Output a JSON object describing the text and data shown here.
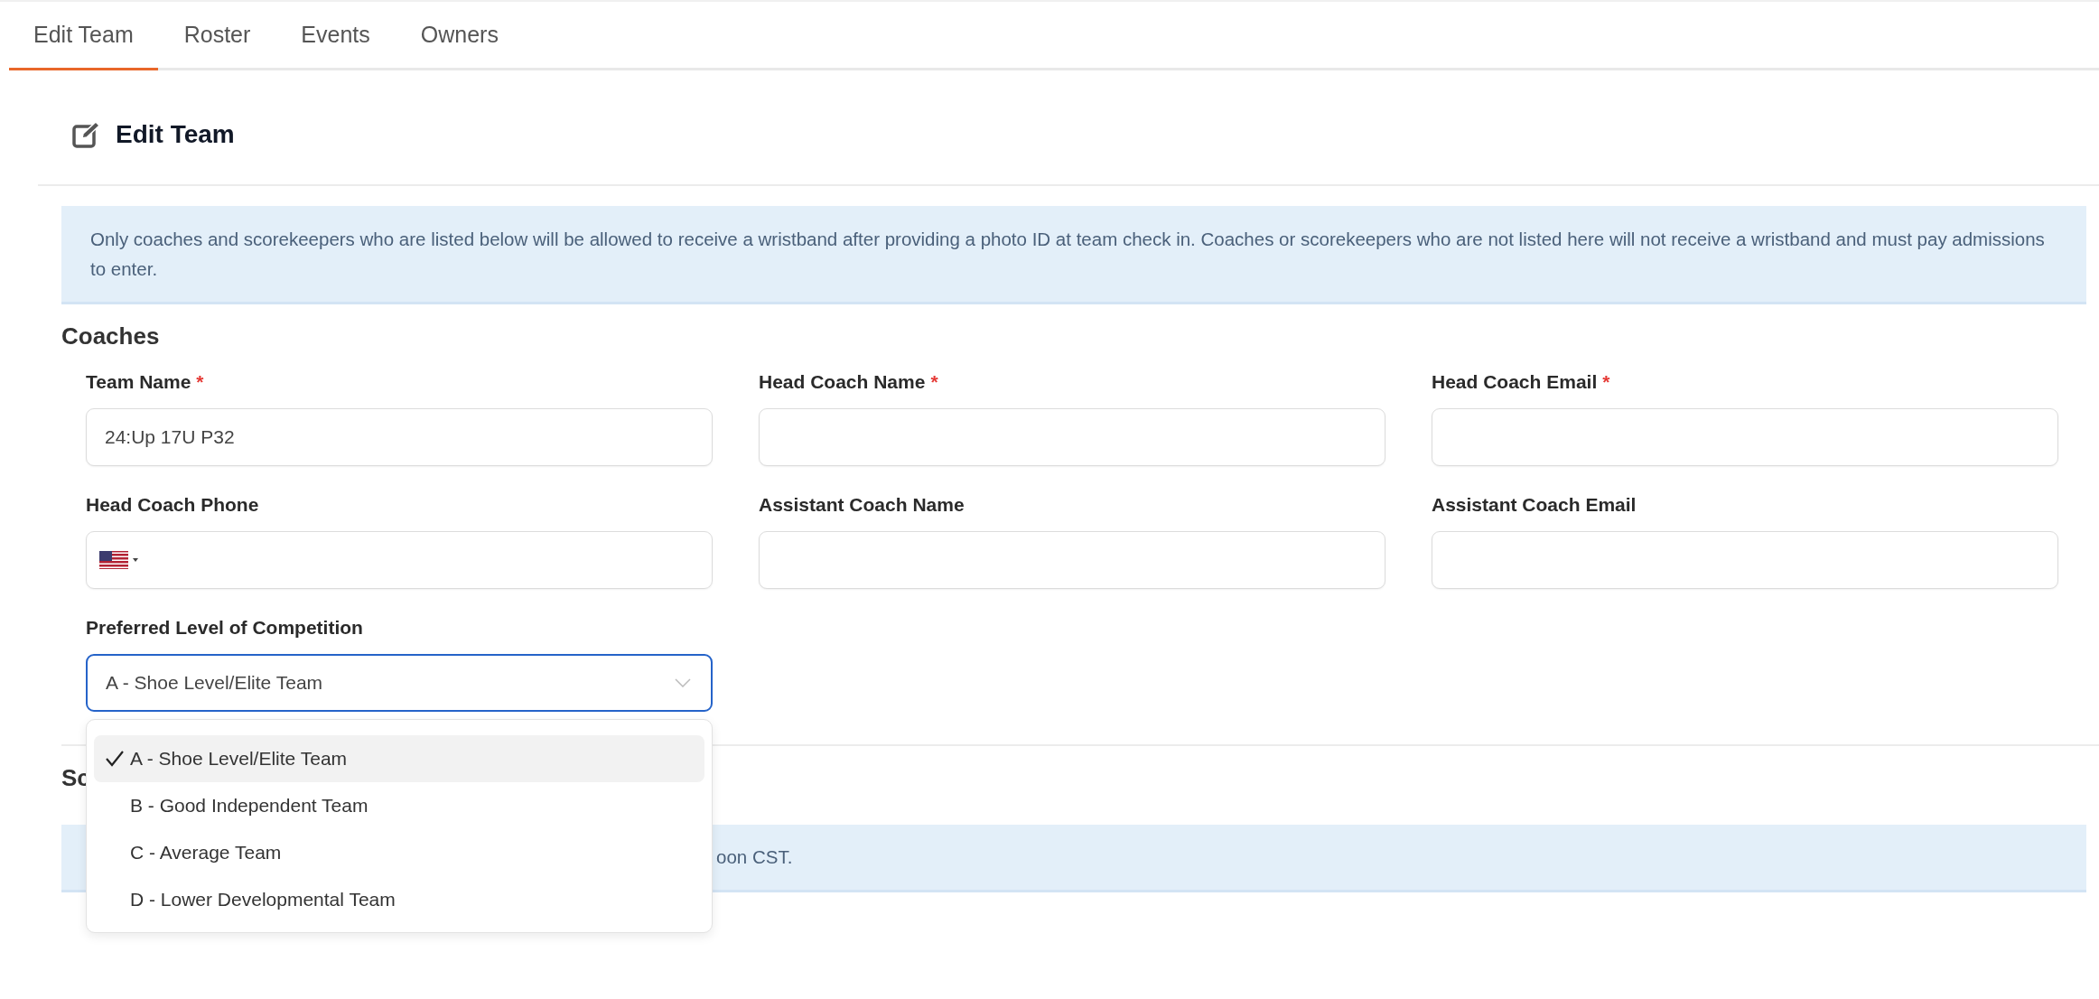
{
  "tabs": [
    {
      "label": "Edit Team",
      "selected": true
    },
    {
      "label": "Roster",
      "selected": false
    },
    {
      "label": "Events",
      "selected": false
    },
    {
      "label": "Owners",
      "selected": false
    }
  ],
  "page_title": "Edit Team",
  "notice": "Only coaches and scorekeepers who are listed below will be allowed to receive a wristband after providing a photo ID at team check in. Coaches or scorekeepers who are not listed here will not receive a wristband and must pay admissions to enter.",
  "coaches": {
    "title": "Coaches",
    "fields": [
      {
        "kind": "text",
        "label": "Team Name",
        "required_mark": "*",
        "value": "24:Up 17U P32"
      },
      {
        "kind": "text",
        "label": "Head Coach Name",
        "required_mark": "*"
      },
      {
        "kind": "text",
        "label": "Head Coach Email",
        "required_mark": "*"
      },
      {
        "kind": "phone",
        "label": "Head Coach Phone"
      },
      {
        "kind": "text",
        "label": "Assistant Coach Name"
      },
      {
        "kind": "text",
        "label": "Assistant Coach Email"
      },
      {
        "kind": "select",
        "label": "Preferred Level of Competition",
        "value": "A - Shoe Level/Elite Team",
        "open": true,
        "options": [
          {
            "label": "A - Shoe Level/Elite Team",
            "selected": true
          },
          {
            "label": "B - Good Independent Team",
            "selected": false
          },
          {
            "label": "C - Average Team",
            "selected": false
          },
          {
            "label": "D - Lower Developmental Team",
            "selected": false
          }
        ]
      }
    ]
  },
  "next_section": {
    "title": "Sc",
    "notice": "oon CST."
  }
}
